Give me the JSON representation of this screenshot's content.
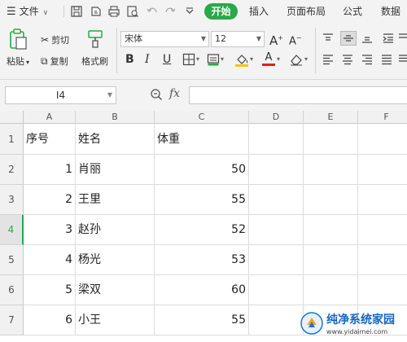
{
  "menubar": {
    "file_label": "文件",
    "tabs": [
      "开始",
      "插入",
      "页面布局",
      "公式",
      "数据"
    ]
  },
  "ribbon": {
    "paste": "粘贴",
    "cut": "剪切",
    "copy": "复制",
    "format_painter": "格式刷",
    "font_name": "宋体",
    "font_size": "12",
    "bold": "B",
    "italic": "I",
    "underline": "U",
    "font_color_letter": "A",
    "grow_font": "A",
    "shrink_font": "A"
  },
  "formula_bar": {
    "cell_ref": "I4",
    "fx": "fx",
    "value": ""
  },
  "sheet": {
    "columns": [
      "A",
      "B",
      "C",
      "D",
      "E",
      "F"
    ],
    "rows": [
      "1",
      "2",
      "3",
      "4",
      "5",
      "6",
      "7"
    ],
    "active_row": "4",
    "cells": [
      [
        "序号",
        "姓名",
        "体重"
      ],
      [
        "1",
        "肖丽",
        "50"
      ],
      [
        "2",
        "王里",
        "55"
      ],
      [
        "3",
        "赵孙",
        "52"
      ],
      [
        "4",
        "杨光",
        "53"
      ],
      [
        "5",
        "梁双",
        "60"
      ],
      [
        "6",
        "小王",
        "55"
      ]
    ]
  },
  "watermark": {
    "title": "纯净系统家园",
    "url": "www.yidaimei.com"
  },
  "colors": {
    "accent": "#2ba84a",
    "toolbar_bg": "#f3f3f3",
    "header_bg": "#f1f1f1",
    "gridline": "#dcdcdc"
  }
}
